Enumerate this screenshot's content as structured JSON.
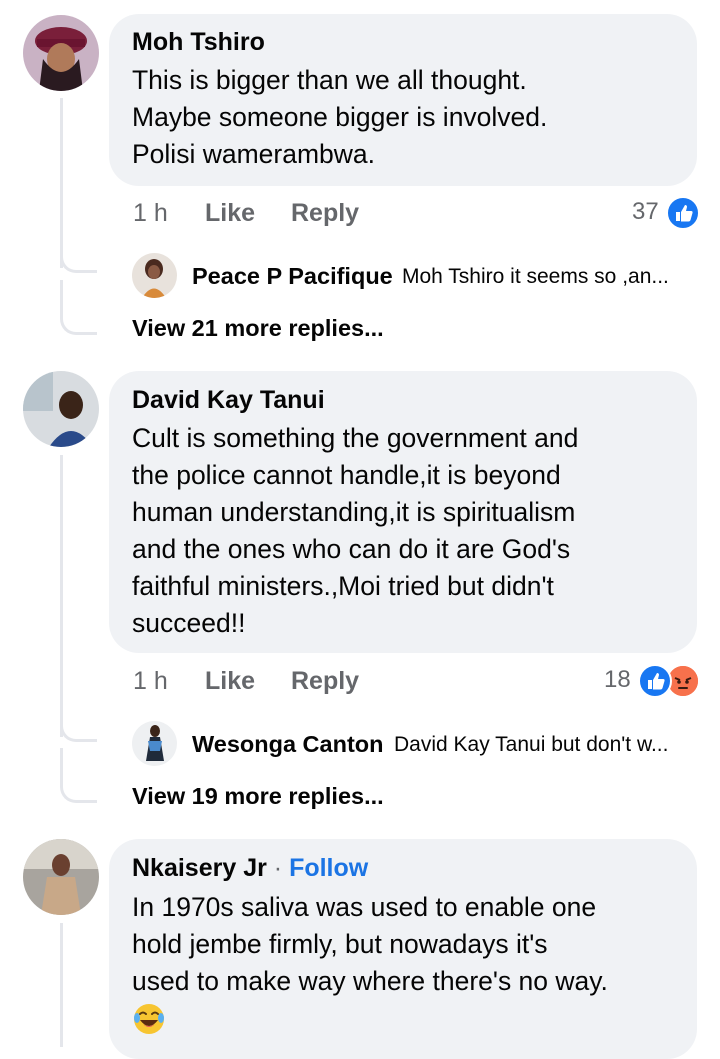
{
  "comments": [
    {
      "author": "Moh Tshiro",
      "lines": [
        "This is bigger than we all thought.",
        "Maybe someone bigger is involved.",
        "Polisi wamerambwa."
      ],
      "time": "1 h",
      "like_label": "Like",
      "reply_label": "Reply",
      "reaction_count": "37",
      "reply_preview": {
        "name": "Peace P Pacifique",
        "snippet": "Moh Tshiro it seems so ,an..."
      },
      "view_more": "View 21 more replies..."
    },
    {
      "author": "David Kay Tanui",
      "lines": [
        "Cult is something the government and",
        "the police cannot handle,it is beyond",
        "human understanding,it is spiritualism",
        "and the ones who can do it are God's",
        "faithful ministers.,Moi tried but didn't",
        "succeed!!"
      ],
      "time": "1 h",
      "like_label": "Like",
      "reply_label": "Reply",
      "reaction_count": "18",
      "reply_preview": {
        "name": "Wesonga Canton",
        "snippet": "David Kay Tanui but don't w..."
      },
      "view_more": "View 19 more replies..."
    },
    {
      "author": "Nkaisery Jr",
      "separator": "·",
      "follow_label": "Follow",
      "lines": [
        "In 1970s saliva was used to enable one",
        "hold jembe firmly, but nowadays it's",
        "used to make way where there's no way."
      ],
      "emoji": "😂"
    }
  ],
  "colors": {
    "like_blue": "#1877f2",
    "angry_orange": "#f7714c",
    "bubble_bg": "#f0f2f5",
    "follow_blue": "#1b74e4"
  },
  "icons": [
    "like-reaction-icon",
    "angry-reaction-icon",
    "laughing-emoji-icon"
  ]
}
